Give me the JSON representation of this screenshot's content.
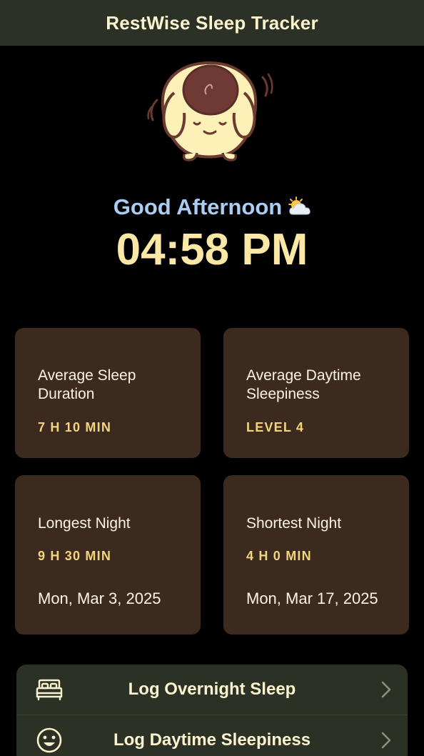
{
  "header": {
    "title": "RestWise Sleep Tracker"
  },
  "greeting": {
    "text": "Good Afternoon",
    "icon": "sun-behind-cloud-icon"
  },
  "clock": {
    "time": "04:58 PM"
  },
  "stats": [
    {
      "title": "Average Sleep Duration",
      "value": "7 H 10 MIN"
    },
    {
      "title": "Average Daytime Sleepiness",
      "value": "LEVEL 4"
    },
    {
      "title": "Longest Night",
      "value": "9 H 30 MIN",
      "date": "Mon, Mar 3, 2025"
    },
    {
      "title": "Shortest Night",
      "value": "4 H 0 MIN",
      "date": "Mon, Mar 17, 2025"
    }
  ],
  "actions": [
    {
      "label": "Log Overnight Sleep",
      "icon": "bed-icon"
    },
    {
      "label": "Log Daytime Sleepiness",
      "icon": "smiley-face-icon"
    }
  ],
  "colors": {
    "header_bg": "#2b3124",
    "card_bg": "#3d2a1f",
    "greeting": "#a9cdf3",
    "clock": "#fbe8a6",
    "value": "#f2d57c"
  }
}
